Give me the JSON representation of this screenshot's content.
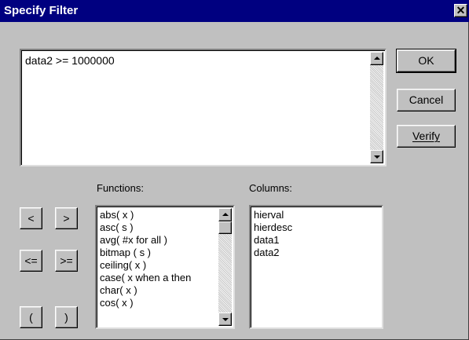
{
  "title": "Specify Filter",
  "close_glyph": "✕",
  "expression": "data2 >= 1000000",
  "buttons": {
    "ok": "OK",
    "cancel": "Cancel",
    "verify": "Verify"
  },
  "operators": {
    "lt": "<",
    "gt": ">",
    "le": "<=",
    "ge": ">=",
    "lparen": "(",
    "rparen": ")"
  },
  "functions": {
    "label": "Functions:",
    "items": [
      "abs( x )",
      "asc( s )",
      "avg( #x for all )",
      "bitmap ( s )",
      "ceiling( x )",
      "case( x when a then",
      "char( x )",
      "cos( x )"
    ]
  },
  "columns": {
    "label": "Columns:",
    "items": [
      "hierval",
      "hierdesc",
      "data1",
      "data2"
    ]
  }
}
